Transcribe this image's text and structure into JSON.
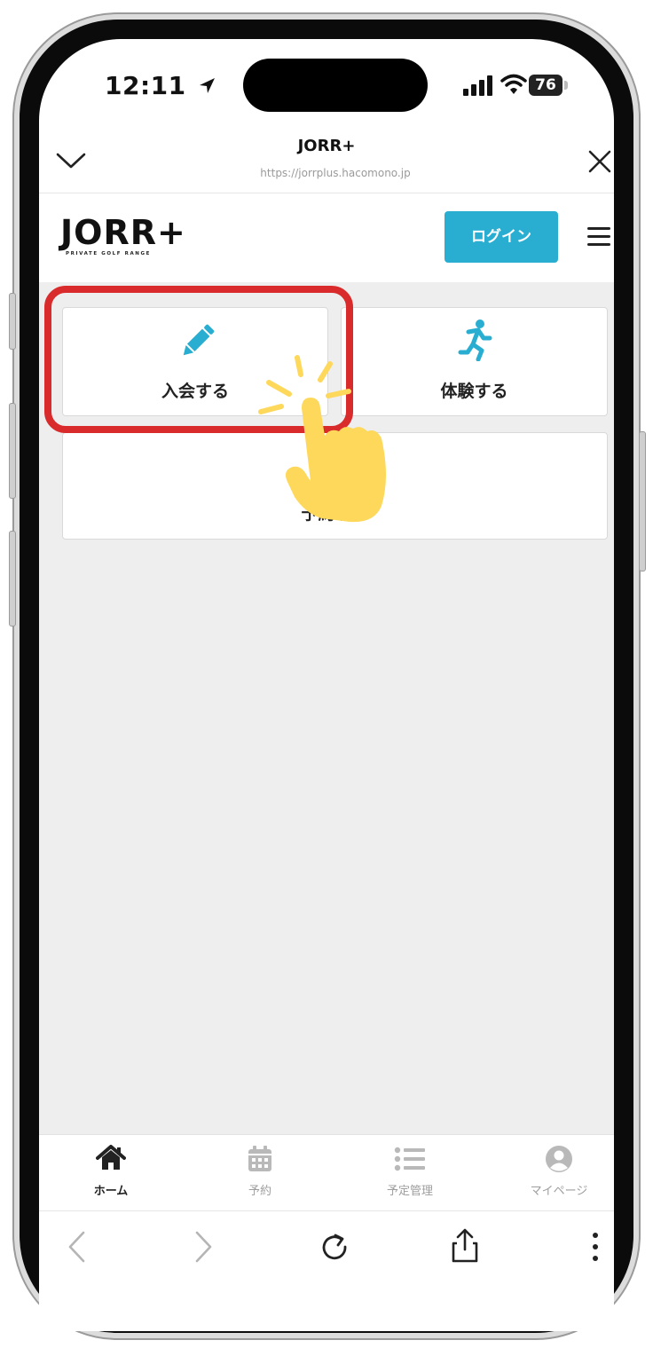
{
  "status_bar": {
    "time": "12:11",
    "battery": "76"
  },
  "browser": {
    "title": "JORR+",
    "url": "https://jorrplus.hacomono.jp"
  },
  "site_header": {
    "logo_text": "JORR+",
    "logo_sub": "PRIVATE GOLF RANGE",
    "login_label": "ログイン"
  },
  "menu_cards": {
    "join_label": "入会する",
    "trial_label": "体験する",
    "reserve_label": "予約する"
  },
  "tab_bar": {
    "items": [
      {
        "label": "ホーム",
        "icon": "home-icon"
      },
      {
        "label": "予約",
        "icon": "calendar-icon"
      },
      {
        "label": "予定管理",
        "icon": "list-icon"
      },
      {
        "label": "マイページ",
        "icon": "user-icon"
      }
    ]
  },
  "colors": {
    "accent": "#29aed1",
    "highlight": "#d92b2b",
    "hand": "#fdd85a"
  }
}
